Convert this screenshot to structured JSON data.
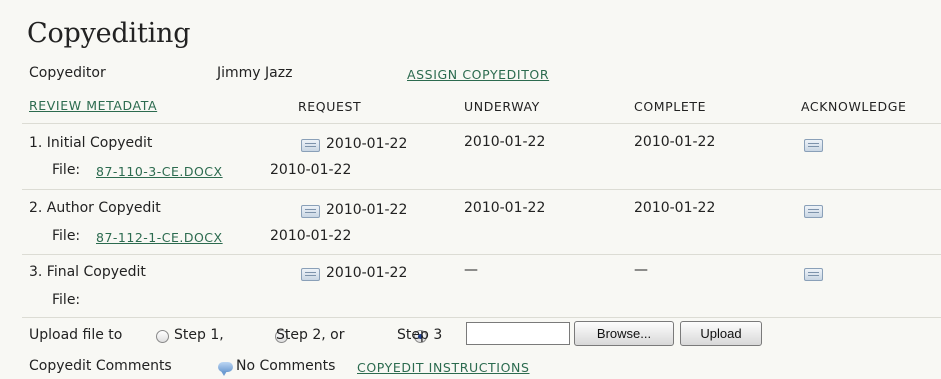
{
  "section_title": "Copyediting",
  "copyeditor": {
    "label": "Copyeditor",
    "name": "Jimmy Jazz",
    "assign_link": "ASSIGN COPYEDITOR"
  },
  "header": {
    "review_metadata": "REVIEW METADATA",
    "request": "REQUEST",
    "underway": "UNDERWAY",
    "complete": "COMPLETE",
    "acknowledge": "ACKNOWLEDGE"
  },
  "file_label": "File:",
  "steps": [
    {
      "label": "1. Initial Copyedit",
      "request": "2010-01-22",
      "underway": "2010-01-22",
      "complete": "2010-01-22",
      "file_name": "87-110-3-CE.DOCX",
      "file_date": "2010-01-22"
    },
    {
      "label": "2. Author Copyedit",
      "request": "2010-01-22",
      "underway": "2010-01-22",
      "complete": "2010-01-22",
      "file_name": "87-112-1-CE.DOCX",
      "file_date": "2010-01-22"
    },
    {
      "label": "3. Final Copyedit",
      "request": "2010-01-22",
      "underway": "—",
      "complete": "—",
      "file_name": "",
      "file_date": ""
    }
  ],
  "upload": {
    "label": "Upload file to",
    "options": [
      "Step 1,",
      "Step 2, or",
      "Step 3"
    ],
    "selected_index": 2,
    "browse_label": "Browse...",
    "upload_label": "Upload"
  },
  "comments": {
    "label": "Copyedit Comments",
    "value": "No Comments",
    "instructions_link": "COPYEDIT INSTRUCTIONS"
  },
  "colors": {
    "link": "#2c6b4f",
    "background": "#f8f8f4",
    "rule": "#dcdcd4"
  }
}
